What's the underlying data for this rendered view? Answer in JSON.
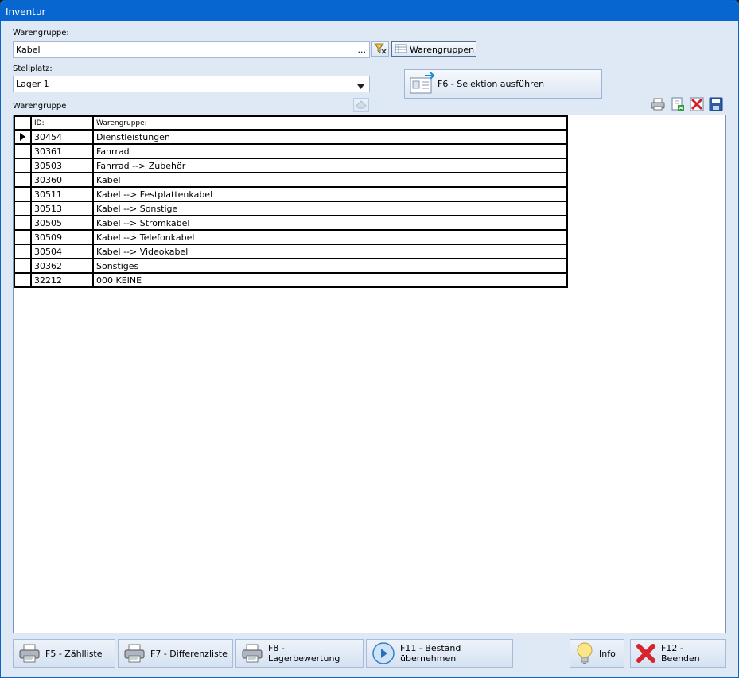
{
  "window": {
    "title": "Inventur"
  },
  "filters": {
    "warengruppe_label": "Warengruppe:",
    "warengruppe_value": "Kabel",
    "ellipsis": "...",
    "warengruppen_button": "Warengruppen",
    "stellplatz_label": "Stellplatz:",
    "stellplatz_value": "Lager 1",
    "selektion_button": "F6 - Selektion ausführen"
  },
  "grid": {
    "caption": "Warengruppe",
    "columns": {
      "id": "ID:",
      "name": "Warengruppe:"
    },
    "rows": [
      {
        "id": "30454",
        "name": "Dienstleistungen"
      },
      {
        "id": "30361",
        "name": "Fahrrad"
      },
      {
        "id": "30503",
        "name": "Fahrrad --> Zubehör"
      },
      {
        "id": "30360",
        "name": "Kabel"
      },
      {
        "id": "30511",
        "name": "Kabel --> Festplattenkabel"
      },
      {
        "id": "30513",
        "name": "Kabel --> Sonstige"
      },
      {
        "id": "30505",
        "name": "Kabel --> Stromkabel"
      },
      {
        "id": "30509",
        "name": "Kabel --> Telefonkabel"
      },
      {
        "id": "30504",
        "name": "Kabel --> Videokabel"
      },
      {
        "id": "30362",
        "name": "Sonstiges"
      },
      {
        "id": "32212",
        "name": "000 KEINE"
      }
    ]
  },
  "footer": {
    "zaehlliste": "F5 - Zählliste",
    "differenzliste": "F7 - Differenzliste",
    "lagerbewertung": "F8 - Lagerbewertung",
    "bestand": "F11 - Bestand übernehmen",
    "info": "Info",
    "beenden": "F12 - Beenden"
  }
}
